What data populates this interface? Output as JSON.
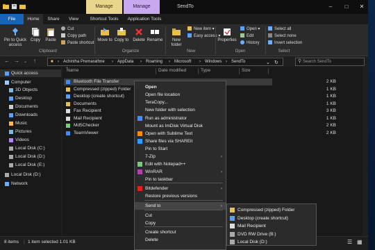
{
  "window": {
    "title": "SendTo",
    "manage1": "Manage",
    "manage2": "Manage",
    "tool1": "Shortcut Tools",
    "tool2": "Application Tools"
  },
  "tabs": [
    "File",
    "Home",
    "Share",
    "View"
  ],
  "ribbon": {
    "pin": "Pin to Quick access",
    "copy": "Copy",
    "paste": "Paste",
    "cut": "Cut",
    "copy_path": "Copy path",
    "paste_shortcut": "Paste shortcut",
    "move_to": "Move to",
    "copy_to": "Copy to",
    "delete": "Delete",
    "rename": "Rename",
    "new_folder": "New folder",
    "new_item": "New item",
    "easy_access": "Easy access",
    "properties": "Properties",
    "open": "Open",
    "edit": "Edit",
    "history": "History",
    "select_all": "Select all",
    "select_none": "Select none",
    "invert_selection": "Invert selection",
    "groups": [
      "Clipboard",
      "Organize",
      "New",
      "Open",
      "Select"
    ]
  },
  "address": {
    "crumbs": [
      "Achintha Premarathne",
      "AppData",
      "Roaming",
      "Microsoft",
      "Windows",
      "SendTo"
    ],
    "search_placeholder": "Search SendTo"
  },
  "columns": [
    "Name",
    "Date modified",
    "Type",
    "Size"
  ],
  "sidebar": [
    {
      "label": "Quick access",
      "icon": "star-icon"
    },
    {
      "label": "Computer",
      "icon": "computer-icon"
    },
    {
      "label": "3D Objects",
      "icon": "cube-icon"
    },
    {
      "label": "Desktop",
      "icon": "desktop-icon"
    },
    {
      "label": "Documents",
      "icon": "documents-icon"
    },
    {
      "label": "Downloads",
      "icon": "download-icon"
    },
    {
      "label": "Music",
      "icon": "music-icon"
    },
    {
      "label": "Pictures",
      "icon": "pictures-icon"
    },
    {
      "label": "Videos",
      "icon": "videos-icon"
    },
    {
      "label": "Local Disk (C:)",
      "icon": "drive-icon"
    },
    {
      "label": "Local Disk (D:)",
      "icon": "drive-icon"
    },
    {
      "label": "Local Disk (E:)",
      "icon": "drive-icon"
    },
    {
      "label": "Local Disk (D:)",
      "icon": "drive-icon"
    },
    {
      "label": "Network",
      "icon": "network-icon"
    }
  ],
  "files": [
    {
      "name": "Bluetooth File Transfer",
      "size": "2 KB"
    },
    {
      "name": "Compressed (zipped) Folder",
      "size": "1 KB"
    },
    {
      "name": "Desktop (create shortcut)",
      "size": "1 KB"
    },
    {
      "name": "Documents",
      "size": "1 KB"
    },
    {
      "name": "Fax Recipient",
      "size": "3 KB"
    },
    {
      "name": "Mail Recipient",
      "size": "1 KB"
    },
    {
      "name": "Md5Checker",
      "size": "2 KB"
    },
    {
      "name": "TeamViewer",
      "size": "2 KB"
    }
  ],
  "context_menu": [
    "Open",
    "Open file location",
    "TeraCopy...",
    "New folder with selection",
    "Run as administrator",
    "Mount as ImDisk Virtual Disk",
    "Open with Sublime Text",
    "Share files via SHAREit",
    "Pin to Start",
    "7-Zip",
    "Edit with Notepad++",
    "WinRAR",
    "Pin to taskbar",
    "Bitdefender",
    "Restore previous versions",
    "Send to",
    "Cut",
    "Copy",
    "Create shortcut",
    "Delete"
  ],
  "send_to": [
    "Compressed (zipped) Folder",
    "Desktop (create shortcut)",
    "Mail Recipient",
    "DVD RW Drive (B:)",
    "Local Disk (D:)"
  ],
  "status": {
    "count": "8 items",
    "selected": "1 item selected  1.01 KB"
  },
  "colors": {
    "accent": "#1765b8",
    "selection": "#3a3a3a"
  }
}
